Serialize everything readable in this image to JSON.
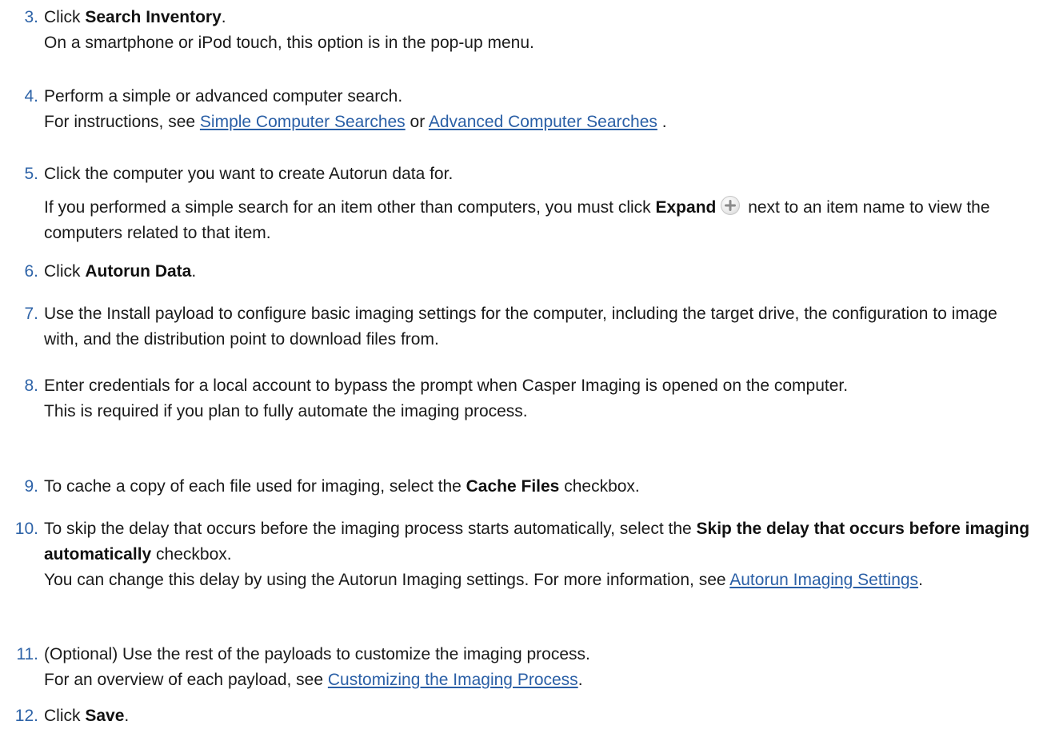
{
  "steps": [
    {
      "num": "3.",
      "action_pre": "Click ",
      "action_bold": "Search Inventory",
      "action_post": ".",
      "note": "On a smartphone or iPod touch, this option is in the pop-up menu."
    },
    {
      "num": "4.",
      "text": "Perform a simple or advanced computer search.",
      "note_pre": "For instructions, see ",
      "link1": "Simple Computer Searches",
      "note_mid": " or ",
      "link2": "Advanced Computer Searches",
      "note_post": " ."
    },
    {
      "num": "5.",
      "text": "Click the computer you want to create Autorun data for.",
      "para_pre": "If you performed a simple search for an item other than computers, you must click ",
      "para_bold": "Expand",
      "para_icon": "plus-circle-icon",
      "para_post": " next to an item name to view the computers related to that item."
    },
    {
      "num": "6.",
      "action_pre": "Click ",
      "action_bold": "Autorun Data",
      "action_post": "."
    },
    {
      "num": "7.",
      "text": "Use the Install payload to configure basic imaging settings for the computer, including the target drive, the configuration to image with, and the distribution point to download files from."
    },
    {
      "num": "8.",
      "text": "Enter credentials for a local account to bypass the prompt when Casper Imaging is opened on the computer.",
      "note": "This is required if you plan to fully automate the imaging process."
    },
    {
      "num": "9.",
      "text_pre": "To cache a copy of each file used for imaging, select the ",
      "text_bold": "Cache Files",
      "text_post": " checkbox."
    },
    {
      "num": "10.",
      "text_pre": "To skip the delay that occurs before the imaging process starts automatically, select the ",
      "text_bold": "Skip the delay that occurs before imaging automatically",
      "text_post": " checkbox.",
      "note_pre": "You can change this delay by using the Autorun Imaging settings. For more information, see ",
      "note_link": "Autorun Imaging Settings",
      "note_post": "."
    },
    {
      "num": "11.",
      "text": "(Optional) Use the rest of the payloads to customize the imaging process.",
      "note_pre": "For an overview of each payload, see ",
      "note_link": "Customizing the Imaging Process",
      "note_post": "."
    },
    {
      "num": "12.",
      "action_pre": "Click ",
      "action_bold": "Save",
      "action_post": "."
    }
  ],
  "colors": {
    "step_number": "#2f64a8",
    "link": "#2a5fa6",
    "text": "#1a1a1a"
  }
}
